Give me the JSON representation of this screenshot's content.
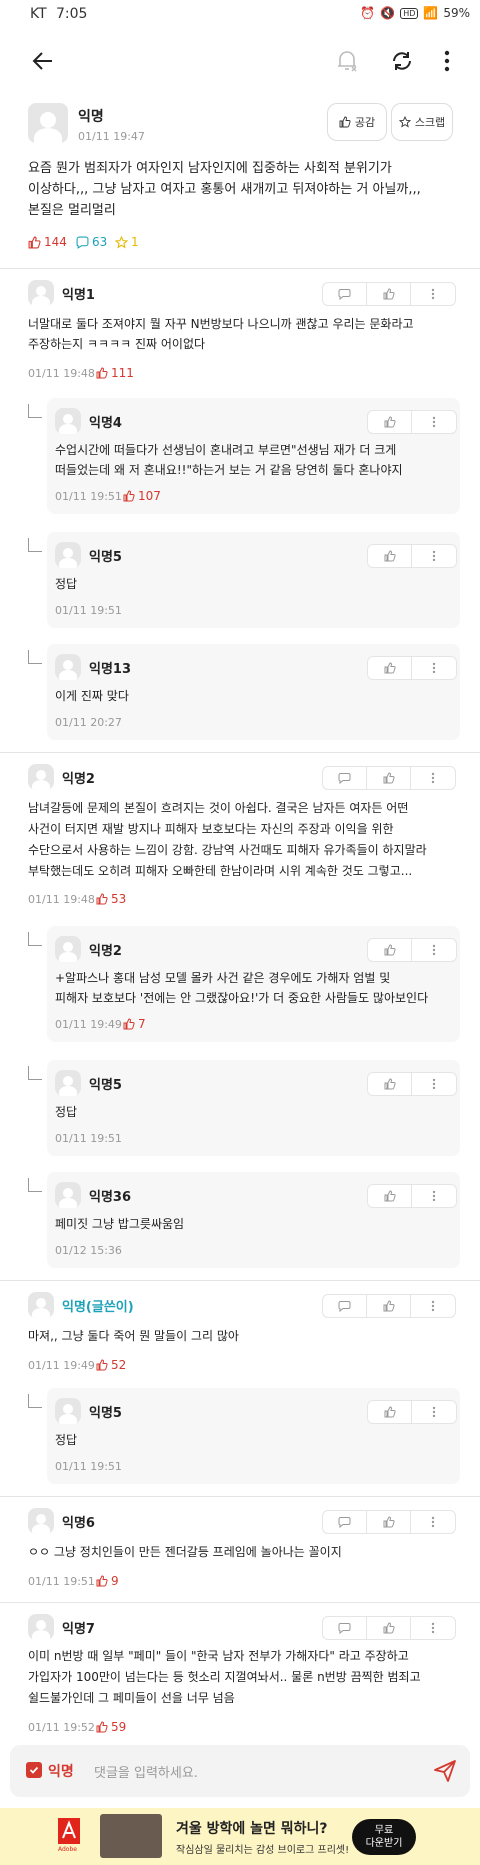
{
  "status_bar": {
    "carrier": "KT",
    "time": "7:05",
    "battery": "59%",
    "hd": "HD"
  },
  "post": {
    "author": "익명",
    "time": "01/11 19:47",
    "like_button_label": "공감",
    "scrap_button_label": "스크랩",
    "body": [
      "요즘 뭔가 범죄자가 여자인지 남자인지에 집중하는 사회적 분위기가",
      "이상하다,,, 그냥 남자고 여자고 홍통어 새개끼고 뒤져야하는 거 아닐까,,,",
      "본질은 멀리멀리"
    ],
    "likes": "144",
    "comments": "63",
    "scraps": "1"
  },
  "comments": [
    {
      "author": "익명1",
      "time": "01/11 19:48",
      "likes": "111",
      "lines": [
        "너말대로 둘다 조져야지 뭘 자꾸 N번방보다 나으니까 괜찮고 우리는 문화라고",
        "주장하는지 ㅋㅋㅋㅋ 진짜 어이없다"
      ]
    },
    {
      "author": "익명4",
      "time": "01/11 19:51",
      "likes": "107",
      "lines": [
        "수업시간에 떠들다가 선생님이 혼내려고 부르면\"선생님 재가 더 크게",
        "떠들었는데 왜 저 혼내요!!\"하는거 보는 거 같음 당연히 둘다 혼나야지"
      ]
    },
    {
      "author": "익명5",
      "time": "01/11 19:51",
      "likes": "",
      "lines": [
        "정답"
      ]
    },
    {
      "author": "익명13",
      "time": "01/11 20:27",
      "likes": "",
      "lines": [
        "이게 진짜 맞다"
      ]
    },
    {
      "author": "익명2",
      "time": "01/11 19:48",
      "likes": "53",
      "lines": [
        "남녀갈등에 문제의 본질이 흐려지는 것이 아쉽다. 결국은 남자든 여자든 어떤",
        "사건이 터지면 재발 방지나 피해자 보호보다는 자신의 주장과 이익을 위한",
        "수단으로서 사용하는 느낌이 강함. 강남역 사건때도 피해자 유가족들이 하지말라",
        "부탁했는데도 오히려 피해자 오빠한테 한남이라며 시위 계속한 것도 그렇고..."
      ]
    },
    {
      "author": "익명2",
      "time": "01/11 19:49",
      "likes": "7",
      "lines": [
        "+알파스나 홍대 남성 모델 몰카 사건 같은 경우에도 가해자 엄벌 및",
        "피해자 보호보다 '전에는 안 그랬잖아요!'가 더 중요한 사람들도 많아보인다"
      ]
    },
    {
      "author": "익명5",
      "time": "01/11 19:51",
      "likes": "",
      "lines": [
        "정답"
      ]
    },
    {
      "author": "익명36",
      "time": "01/12 15:36",
      "likes": "",
      "lines": [
        "페미짓 그냥 밥그릇싸움임"
      ]
    },
    {
      "author": "익명(글쓴이)",
      "time": "01/11 19:49",
      "likes": "52",
      "lines": [
        "마져,, 그냥 둘다 죽어 뭔 말들이 그리 많아"
      ]
    },
    {
      "author": "익명5",
      "time": "01/11 19:51",
      "likes": "",
      "lines": [
        "정답"
      ]
    },
    {
      "author": "익명6",
      "time": "01/11 19:51",
      "likes": "9",
      "lines": [
        "ㅇㅇ 그냥 정치인들이 만든 젠더갈등 프레임에 놀아나는 꼴이지"
      ]
    },
    {
      "author": "익명7",
      "time": "01/11 19:52",
      "likes": "59",
      "lines": [
        "이미 n번방 때 일부 \"페미\" 들이 \"한국 남자 전부가 가해자다\" 라고 주장하고",
        "가입자가 100만이 넘는다는 등 헛소리 지껄여놔서.. 물론 n번방 끔찍한 범죄고",
        "쉴드불가인데 그 페미들이 선을 너무 넘음"
      ]
    }
  ],
  "input": {
    "anon_label": "익명",
    "placeholder": "댓글을 입력하세요."
  },
  "ad": {
    "brand": "Adobe",
    "title": "겨울 방학에 놀면 뭐하니?",
    "subtitle": "작심삼일 물리치는 감성 브이로그 프리셋!",
    "cta_line1": "무료",
    "cta_line2": "다운받기"
  }
}
